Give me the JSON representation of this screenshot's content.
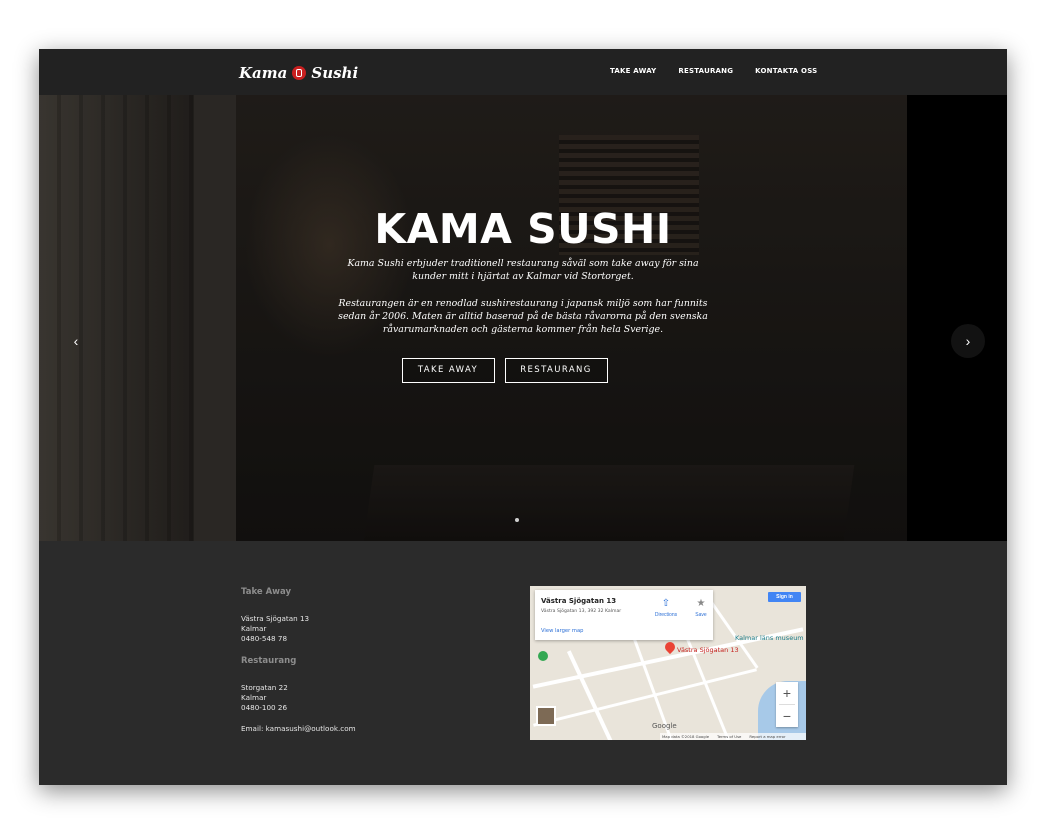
{
  "nav": {
    "logo_left": "Kama",
    "logo_right": "Sushi",
    "links": [
      "TAKE AWAY",
      "RESTAURANG",
      "KONTAKTA OSS"
    ]
  },
  "hero": {
    "title": "KAMA SUSHI",
    "paragraph1": "Kama Sushi erbjuder traditionell restaurang såväl som take away för sina kunder mitt i hjärtat av Kalmar vid Stortorget.",
    "paragraph2": "Restaurangen är en renodlad sushirestaurang i japansk miljö som har funnits sedan år 2006. Maten är alltid baserad på de bästa råvarorna på den svenska råvarumarknaden och gästerna kommer från hela Sverige.",
    "button_takeaway": "TAKE AWAY",
    "button_restaurang": "RESTAURANG",
    "prev_arrow": "‹",
    "next_arrow": "›"
  },
  "footer": {
    "takeaway_heading": "Take Away",
    "takeaway_address": "Västra Sjögatan 13",
    "takeaway_city": "Kalmar",
    "takeaway_phone": "0480-548 78",
    "restaurang_heading": "Restaurang",
    "restaurang_address": "Storgatan 22",
    "restaurang_city": "Kalmar",
    "restaurang_phone": "0480-100 26",
    "email": "Email: kamasushi@outlook.com"
  },
  "map": {
    "place_title": "Västra Sjögatan 13",
    "place_address": "Västra Sjögatan 13, 392 32 Kalmar",
    "directions_label": "Directions",
    "save_label": "Save",
    "view_larger": "View larger map",
    "sign_in": "Sign in",
    "pin_label": "Västra Sjögatan 13",
    "museum_label": "Kalmar läns museum",
    "zoom_in": "+",
    "zoom_out": "−",
    "google_label": "Google",
    "map_data": "Map data ©2018 Google",
    "terms": "Terms of Use",
    "report": "Report a map error"
  }
}
